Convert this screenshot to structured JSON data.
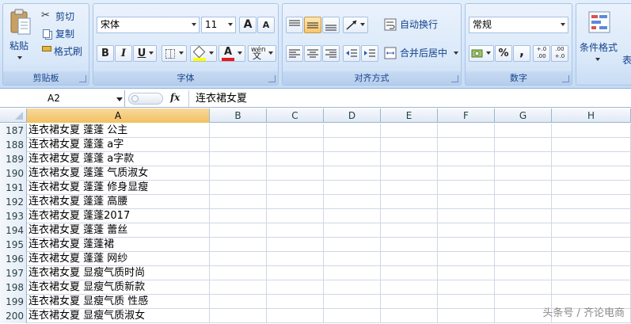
{
  "ribbon": {
    "clipboard": {
      "paste_label": "粘贴",
      "cut_label": "剪切",
      "copy_label": "复制",
      "format_painter_label": "格式刷",
      "group_label": "剪贴板"
    },
    "font": {
      "font_name": "宋体",
      "font_size": "11",
      "grow_label": "A",
      "shrink_label": "A",
      "bold_label": "B",
      "italic_label": "I",
      "underline_label": "U",
      "phonetic_label": "wén",
      "font_color_label": "A",
      "group_label": "字体"
    },
    "alignment": {
      "wrap_text_label": "自动换行",
      "merge_center_label": "合并后居中",
      "group_label": "对齐方式"
    },
    "number": {
      "format": "常规",
      "percent_label": "%",
      "comma_label": ",",
      "increase_decimal_label": "+.0 .00",
      "decrease_decimal_label": ".00 +.0",
      "group_label": "数字"
    },
    "styles": {
      "conditional_format_label": "条件格式",
      "table_label": "表"
    }
  },
  "formula_bar": {
    "cell_ref": "A2",
    "fx_label": "fx",
    "content": "连衣裙女夏"
  },
  "columns": [
    "A",
    "B",
    "C",
    "D",
    "E",
    "F",
    "G",
    "H"
  ],
  "rows": [
    {
      "num": "187",
      "a": "连衣裙女夏 蓬蓬 公主"
    },
    {
      "num": "188",
      "a": "连衣裙女夏 蓬蓬 a字"
    },
    {
      "num": "189",
      "a": "连衣裙女夏 蓬蓬 a字款"
    },
    {
      "num": "190",
      "a": "连衣裙女夏 蓬蓬 气质淑女"
    },
    {
      "num": "191",
      "a": "连衣裙女夏 蓬蓬 修身显瘦"
    },
    {
      "num": "192",
      "a": "连衣裙女夏 蓬蓬 高腰"
    },
    {
      "num": "193",
      "a": "连衣裙女夏 蓬蓬2017"
    },
    {
      "num": "194",
      "a": "连衣裙女夏 蓬蓬 蕾丝"
    },
    {
      "num": "195",
      "a": "连衣裙女夏 蓬蓬裙"
    },
    {
      "num": "196",
      "a": "连衣裙女夏 蓬蓬 网纱"
    },
    {
      "num": "197",
      "a": "连衣裙女夏 显瘦气质时尚"
    },
    {
      "num": "198",
      "a": "连衣裙女夏 显瘦气质新款"
    },
    {
      "num": "199",
      "a": "连衣裙女夏 显瘦气质 性感"
    },
    {
      "num": "200",
      "a": "连衣裙女夏 显瘦气质淑女"
    }
  ],
  "watermark": "头条号 / 齐论电商",
  "colors": {
    "ribbon_bg": "#d6e6f8",
    "selected_header": "#f1c15f",
    "grid_line": "#d0d7e5"
  }
}
